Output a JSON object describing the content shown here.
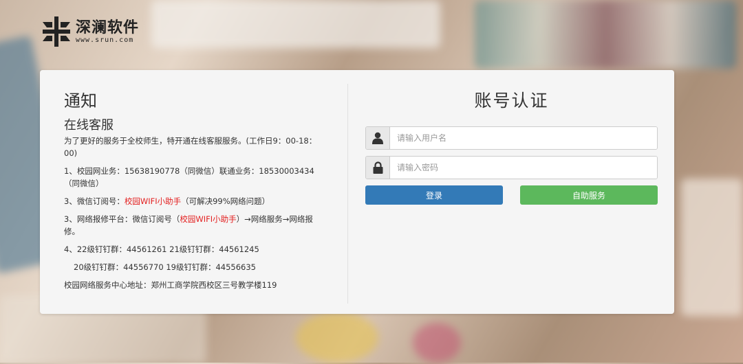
{
  "logo": {
    "name": "深澜软件",
    "url": "www.srun.com"
  },
  "notice": {
    "title": "通知",
    "subtitle": "在线客服",
    "lines": [
      {
        "text": "为了更好的服务于全校师生，特开通在线客服服务。(工作日9：00-18：00)"
      },
      {
        "text": "1、校园网业务：15638190778（同微信）联通业务：18530003434（同微信）"
      },
      {
        "pre": "3、微信订阅号：",
        "highlight": "校园WIFI小助手",
        "post": "（可解决99%网络问题）"
      },
      {
        "pre": "3、网络报修平台：微信订阅号（",
        "highlight": "校园WIFI小助手",
        "post": "）→网络服务→网络报修。"
      },
      {
        "text": "4、22级钉钉群：44561261 21级钉钉群：44561245"
      },
      {
        "text": "20级钉钉群：44556770 19级钉钉群：44556635"
      },
      {
        "text": "校园网络服务中心地址：郑州工商学院西校区三号教学楼119"
      }
    ]
  },
  "auth": {
    "title": "账号认证",
    "username_placeholder": "请输入用户名",
    "password_placeholder": "请输入密码",
    "login_label": "登录",
    "self_service_label": "自助服务"
  },
  "colors": {
    "login": "#337ab7",
    "self_service": "#5cb85c",
    "highlight": "#e32020"
  }
}
